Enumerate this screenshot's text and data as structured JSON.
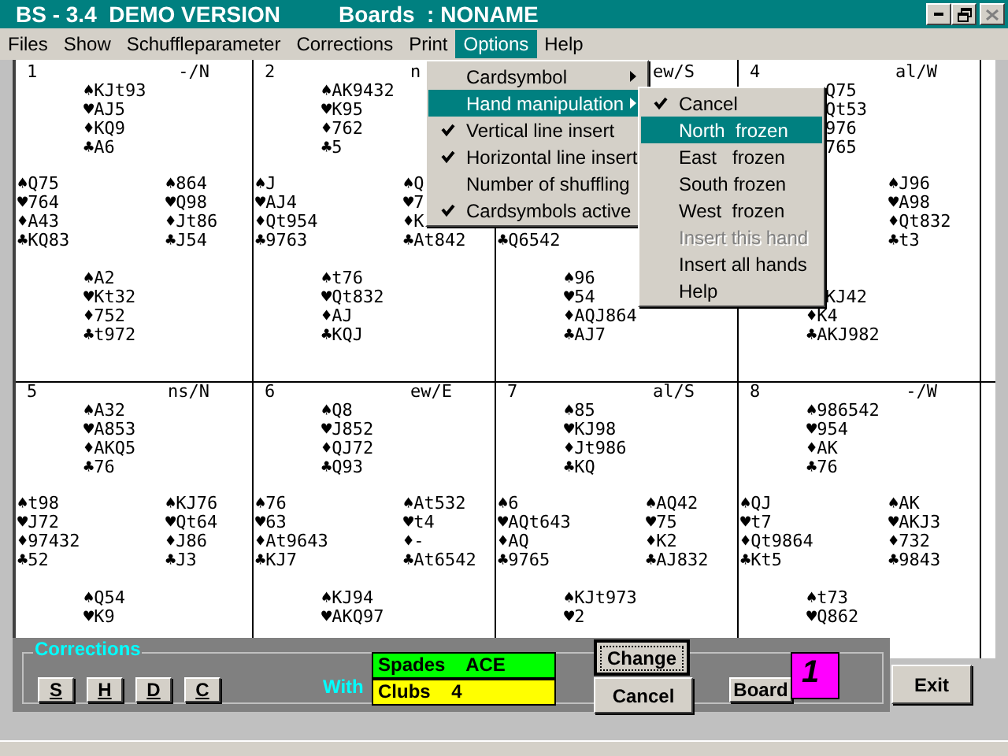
{
  "window": {
    "title": "BS - 3.4  DEMO VERSION",
    "subtitle": "Boards  : NONAME"
  },
  "menu_bar": [
    {
      "label": "Files",
      "selected": false
    },
    {
      "label": "Show",
      "selected": false
    },
    {
      "label": "Schuffleparameter",
      "selected": false
    },
    {
      "label": "Corrections",
      "selected": false
    },
    {
      "label": "Print",
      "selected": false
    },
    {
      "label": "Options",
      "selected": true
    },
    {
      "label": "Help",
      "selected": false
    }
  ],
  "boards": [
    {
      "number": "1",
      "info": "-/N",
      "north": {
        "spades": "♠KJt93",
        "hearts": "♥AJ5",
        "diamonds": "♦KQ9",
        "clubs": "♣A6"
      },
      "west": {
        "spades": "♠Q75",
        "hearts": "♥764",
        "diamonds": "♦A43",
        "clubs": "♣KQ83"
      },
      "east": {
        "spades": "♠864",
        "hearts": "♥Q98",
        "diamonds": "♦Jt86",
        "clubs": "♣J54"
      },
      "south": {
        "spades": "♠A2",
        "hearts": "♥Kt32",
        "diamonds": "♦752",
        "clubs": "♣t972"
      }
    },
    {
      "number": "2",
      "info": {
        "text": "n",
        "cut_end": true
      },
      "north": {
        "spades": "♠AK9432",
        "hearts": "♥K95",
        "diamonds": "♦762",
        "clubs": "♣5"
      },
      "west": {
        "spades": "♠J",
        "hearts": "♥AJ4",
        "diamonds": "♦Qt954",
        "clubs": "♣9763"
      },
      "east": {
        "spades": "♠Q",
        "hearts": "♥7",
        "diamonds": "♦K",
        "clubs": "♣At842"
      },
      "south": {
        "spades": "♠t76",
        "hearts": "♥Qt832",
        "diamonds": "♦AJ",
        "clubs": "♣KQJ"
      }
    },
    {
      "info": "ew/S",
      "west": {
        "clubs": "♣Q6542"
      },
      "south": {
        "spades": "♠96",
        "hearts": "♥54",
        "diamonds": "♦AQJ864",
        "clubs": "♣AJ7"
      }
    },
    {
      "number": "4",
      "info": "al/W",
      "north": {
        "spades": {
          "text": "Q75",
          "cut_start": true
        },
        "hearts": {
          "text": "Qt53",
          "cut_start": true
        },
        "diamonds": {
          "text": "976",
          "cut_start": true
        },
        "clubs": {
          "text": "765",
          "cut_start": true
        }
      },
      "east": {
        "spades": "♠J96",
        "hearts": "♥A98",
        "diamonds": "♦Qt832",
        "clubs": "♣t3"
      },
      "south": {
        "hearts": {
          "text": "KJ42",
          "cut_start": true
        },
        "diamonds": "♦K4",
        "clubs": "♣AKJ982"
      }
    },
    {
      "number": "5",
      "info": "ns/N",
      "north": {
        "spades": "♠A32",
        "hearts": "♥A853",
        "diamonds": "♦AKQ5",
        "clubs": "♣76"
      },
      "west": {
        "spades": "♠t98",
        "hearts": "♥J72",
        "diamonds": "♦97432",
        "clubs": "♣52"
      },
      "east": {
        "spades": "♠KJ76",
        "hearts": "♥Qt64",
        "diamonds": "♦J86",
        "clubs": "♣J3"
      },
      "south": {
        "spades": "♠Q54",
        "hearts": "♥K9"
      }
    },
    {
      "number": "6",
      "info": "ew/E",
      "north": {
        "spades": "♠Q8",
        "hearts": "♥J852",
        "diamonds": "♦QJ72",
        "clubs": "♣Q93"
      },
      "west": {
        "spades": "♠76",
        "hearts": "♥63",
        "diamonds": "♦At9643",
        "clubs": "♣KJ7"
      },
      "east": {
        "spades": "♠At532",
        "hearts": "♥t4",
        "diamonds": "♦-",
        "clubs": "♣At6542"
      },
      "south": {
        "spades": "♠KJ94",
        "hearts": "♥AKQ97"
      }
    },
    {
      "number": "7",
      "info": "al/S",
      "north": {
        "spades": "♠85",
        "hearts": "♥KJ98",
        "diamonds": "♦Jt986",
        "clubs": "♣KQ"
      },
      "west": {
        "spades": "♠6",
        "hearts": "♥AQt643",
        "diamonds": "♦AQ",
        "clubs": "♣9765"
      },
      "east": {
        "spades": "♠AQ42",
        "hearts": "♥75",
        "diamonds": "♦K2",
        "clubs": "♣AJ832"
      },
      "south": {
        "spades": "♠KJt973",
        "hearts": "♥2"
      }
    },
    {
      "number": "8",
      "info": "-/W",
      "north": {
        "spades": "♠986542",
        "hearts": "♥954",
        "diamonds": "♦AK",
        "clubs": "♣76"
      },
      "west": {
        "spades": "♠QJ",
        "hearts": "♥t7",
        "diamonds": "♦Qt9864",
        "clubs": "♣Kt5"
      },
      "east": {
        "spades": "♠AK",
        "hearts": "♥AKJ3",
        "diamonds": "♦732",
        "clubs": "♣9843"
      },
      "south": {
        "spades": "♠t73",
        "hearts": "♥Q862"
      }
    }
  ],
  "options_menu": [
    {
      "label": "Cardsymbol",
      "kind": "submenu",
      "checked": false,
      "selected": false
    },
    {
      "label": "Hand manipulation",
      "kind": "submenu",
      "checked": false,
      "selected": true
    },
    {
      "label": "Vertical line insert",
      "kind": "item",
      "checked": true,
      "selected": false
    },
    {
      "label": "Horizontal line insert",
      "kind": "item",
      "checked": true,
      "selected": false
    },
    {
      "label": "Number of shuffling",
      "kind": "item",
      "checked": false,
      "selected": false
    },
    {
      "label": "Cardsymbols active",
      "kind": "item",
      "checked": true,
      "selected": false
    }
  ],
  "hand_menu": [
    {
      "label": "Cancel",
      "checked": true,
      "selected": false,
      "disabled": false
    },
    {
      "label": "North  frozen",
      "checked": false,
      "selected": true,
      "disabled": false
    },
    {
      "label": "East   frozen",
      "checked": false,
      "selected": false,
      "disabled": false
    },
    {
      "label": "South frozen",
      "checked": false,
      "selected": false,
      "disabled": false
    },
    {
      "label": "West  frozen",
      "checked": false,
      "selected": false,
      "disabled": false
    },
    {
      "label": "Insert this hand",
      "checked": false,
      "selected": false,
      "disabled": true
    },
    {
      "label": "Insert all hands",
      "checked": false,
      "selected": false,
      "disabled": false
    },
    {
      "label": "Help",
      "checked": false,
      "selected": false,
      "disabled": false
    }
  ],
  "corrections": {
    "title": "Corrections",
    "suit_buttons": [
      "S",
      "H",
      "D",
      "C"
    ],
    "with_label": "With",
    "fields": [
      {
        "value": "Spades    ACE",
        "color": "#00ff00"
      },
      {
        "value": "Clubs    4",
        "color": "#ffff00"
      }
    ],
    "buttons": [
      {
        "label": "Change",
        "focused": true
      },
      {
        "label": "Cancel",
        "focused": false
      }
    ],
    "board_button": "Board",
    "board_number": "1"
  },
  "exit_button": "Exit"
}
